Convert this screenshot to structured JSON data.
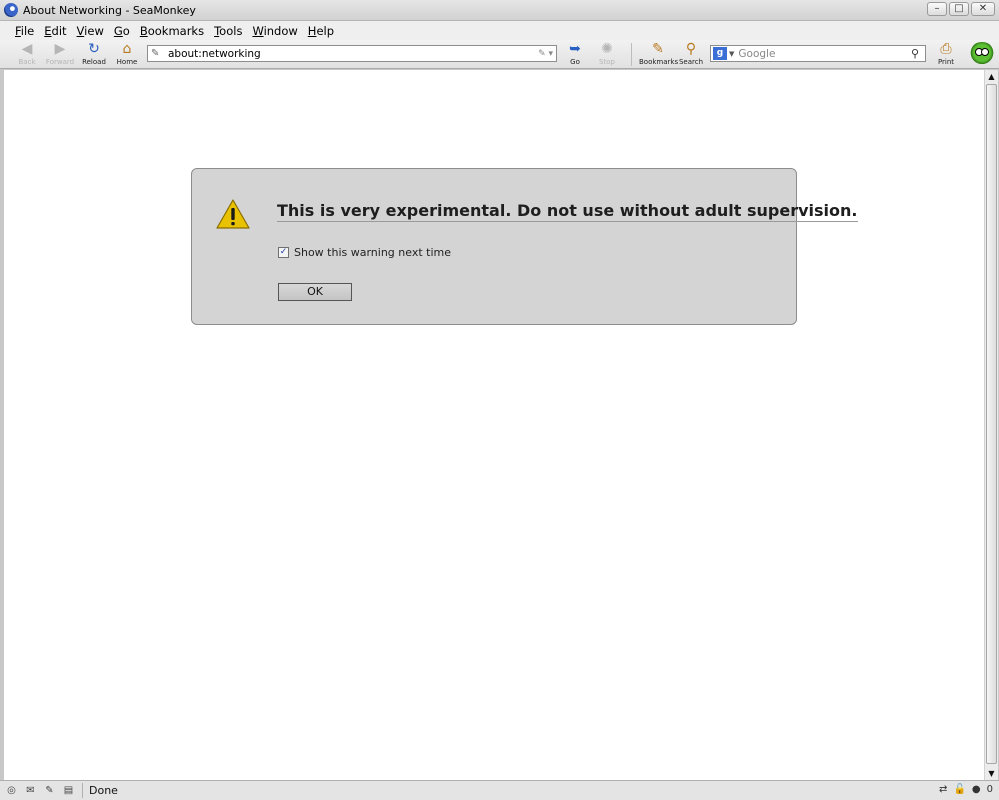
{
  "window": {
    "title": "About Networking - SeaMonkey",
    "controls": {
      "minimize": "–",
      "maximize": "□",
      "close": "✕"
    }
  },
  "menu": {
    "items": [
      {
        "first": "F",
        "rest": "ile"
      },
      {
        "first": "E",
        "rest": "dit"
      },
      {
        "first": "V",
        "rest": "iew"
      },
      {
        "first": "G",
        "rest": "o"
      },
      {
        "first": "B",
        "rest": "ookmarks"
      },
      {
        "first": "T",
        "rest": "ools"
      },
      {
        "first": "W",
        "rest": "indow"
      },
      {
        "first": "H",
        "rest": "elp"
      }
    ]
  },
  "toolbar": {
    "back": {
      "label": "Back",
      "icon": "back-arrow-icon",
      "glyph": "◀"
    },
    "forward": {
      "label": "Forward",
      "icon": "forward-arrow-icon",
      "glyph": "▶"
    },
    "reload": {
      "label": "Reload",
      "icon": "reload-icon",
      "glyph": "↻"
    },
    "home": {
      "label": "Home",
      "icon": "home-icon",
      "glyph": "⌂"
    },
    "go": {
      "label": "Go",
      "icon": "go-arrow-icon",
      "glyph": "➥"
    },
    "stop": {
      "label": "Stop",
      "icon": "stop-icon",
      "glyph": "✺"
    },
    "bookmarks": {
      "label": "Bookmarks",
      "icon": "bookmarks-icon",
      "glyph": "✎"
    },
    "search": {
      "label": "Search",
      "icon": "search-icon",
      "glyph": "⚲"
    },
    "print": {
      "label": "Print",
      "icon": "print-icon",
      "glyph": "⎙"
    },
    "url": "about:networking",
    "search_placeholder": "Google",
    "search_engine_glyph": "g"
  },
  "page": {
    "warning_title": "This is very experimental. Do not use without adult supervision.",
    "checkbox_label": "Show this warning next time",
    "checkbox_checked": true,
    "ok_label": "OK"
  },
  "statusbar": {
    "text": "Done",
    "popup_count": "0"
  },
  "colors": {
    "warning_box_bg": "#d4d4d4",
    "warning_icon_yellow": "#e8c200",
    "accent_blue": "#3b6fd6"
  }
}
